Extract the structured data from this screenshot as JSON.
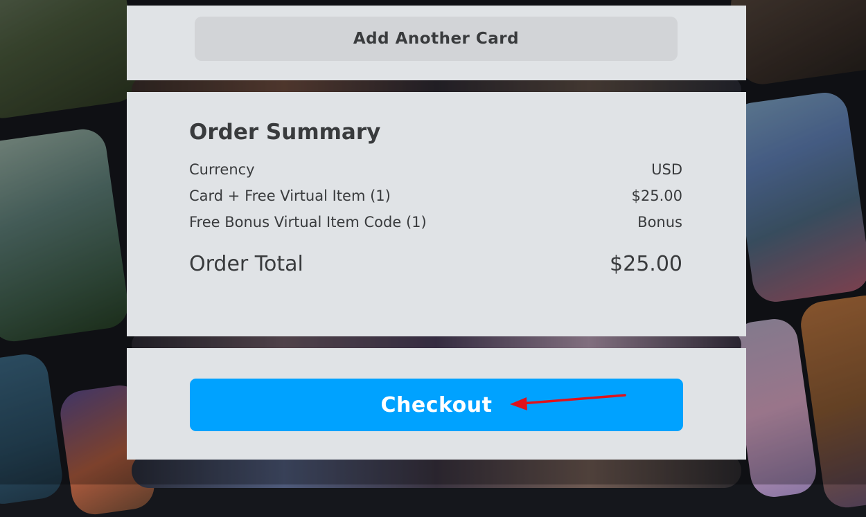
{
  "add_card": {
    "label": "Add Another Card"
  },
  "order_summary": {
    "title": "Order Summary",
    "rows": [
      {
        "label": "Currency",
        "value": "USD"
      },
      {
        "label": "Card + Free Virtual Item (1)",
        "value": "$25.00"
      },
      {
        "label": "Free Bonus Virtual Item Code (1)",
        "value": "Bonus"
      }
    ],
    "total": {
      "label": "Order Total",
      "value": "$25.00"
    }
  },
  "checkout": {
    "label": "Checkout",
    "color": "#00a2ff"
  },
  "annotation": {
    "arrow_color": "#e0121b"
  }
}
